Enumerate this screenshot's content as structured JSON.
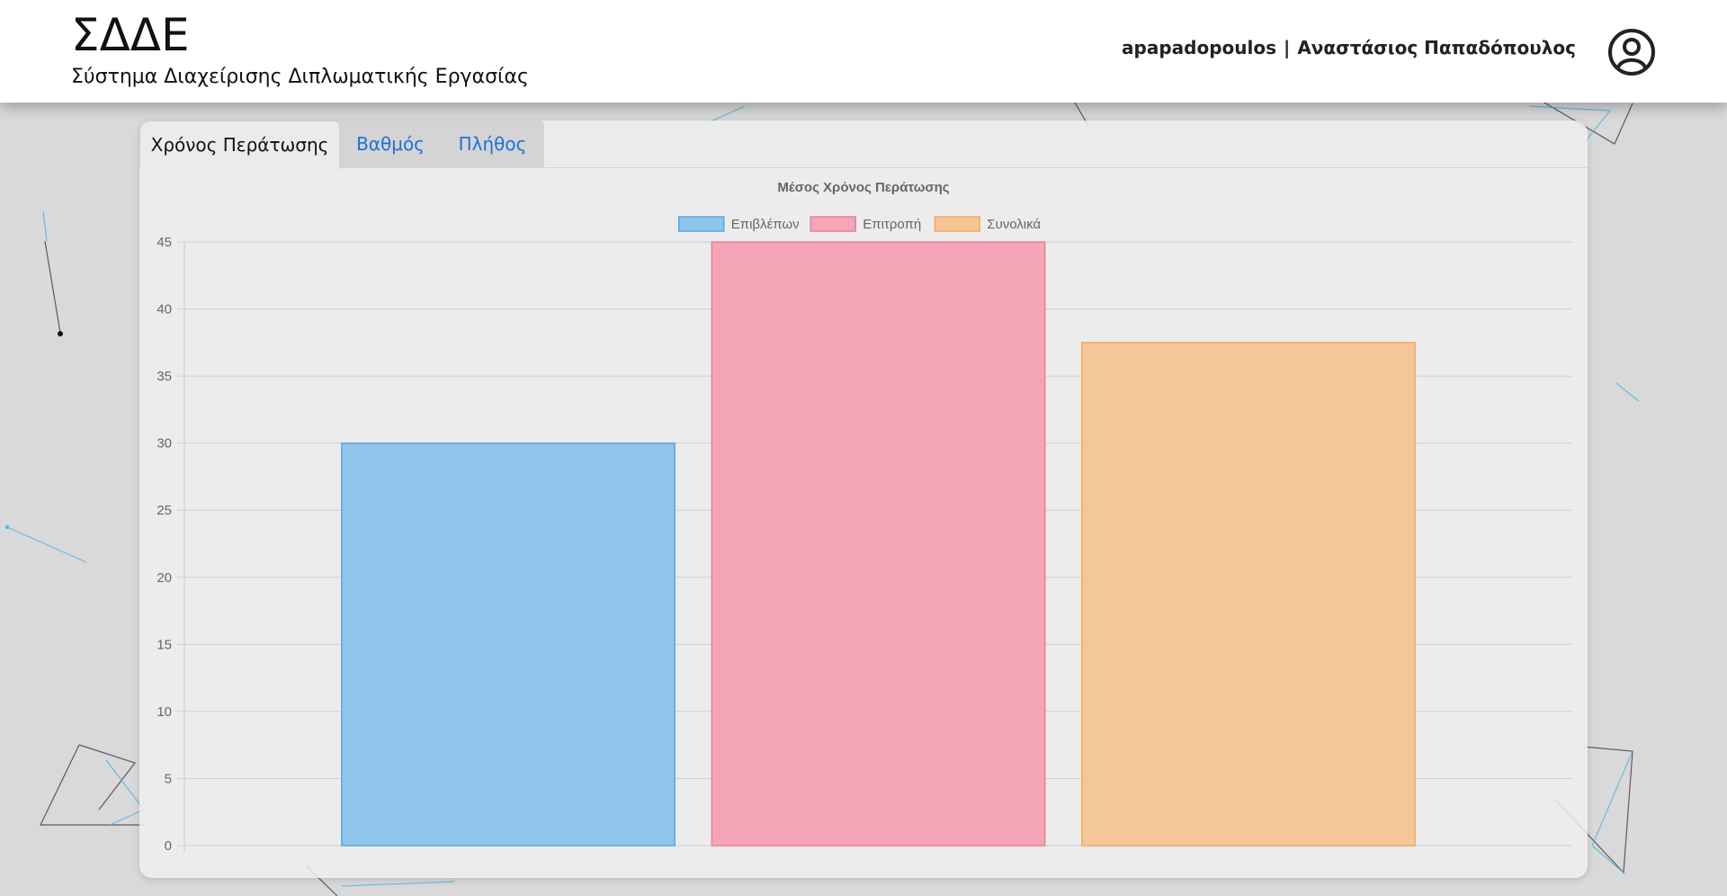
{
  "header": {
    "title": "ΣΔΔΕ",
    "subtitle": "Σύστημα Διαχείρισης Διπλωματικής Εργασίας",
    "username": "apapadopoulos",
    "separator": "|",
    "full_name": "Αναστάσιος Παπαδόπουλος",
    "avatar_icon": "user-circle-icon"
  },
  "tabs": [
    {
      "label": "Χρόνος Περάτωσης",
      "active": true
    },
    {
      "label": "Βαθμός",
      "active": false
    },
    {
      "label": "Πλήθος",
      "active": false
    }
  ],
  "colors": {
    "tab_link": "#1a73d8",
    "bar_supervisor": "#90c5ec",
    "bar_committee": "#f4a5b7",
    "bar_total": "#f5c796"
  },
  "chart_data": {
    "type": "bar",
    "title": "Μέσος Χρόνος Περάτωσης",
    "categories": [
      ""
    ],
    "series": [
      {
        "name": "Επιβλέπων",
        "values": [
          30
        ],
        "color": "#90c5ec",
        "border": "#5aa6e0"
      },
      {
        "name": "Επιτροπή",
        "values": [
          45
        ],
        "color": "#f4a5b7",
        "border": "#ee7d97"
      },
      {
        "name": "Συνολικά",
        "values": [
          37.5
        ],
        "color": "#f5c796",
        "border": "#f0a95e"
      }
    ],
    "ylim": [
      0,
      45
    ],
    "yticks": [
      0,
      5,
      10,
      15,
      20,
      25,
      30,
      35,
      40,
      45
    ],
    "grid": true,
    "legend": "top"
  }
}
